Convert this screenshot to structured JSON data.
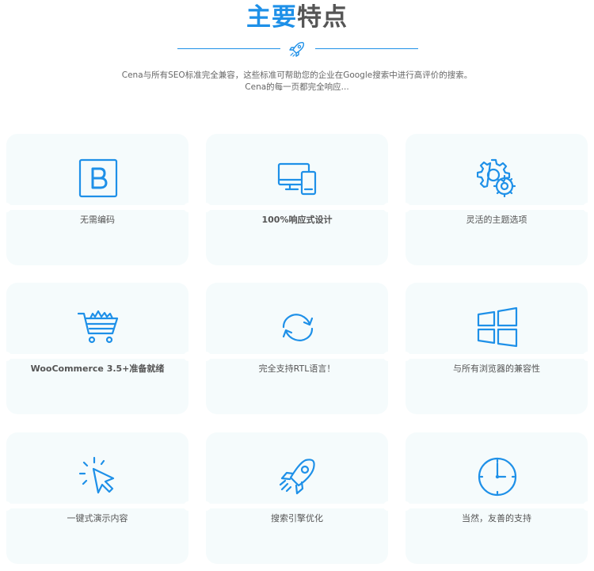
{
  "header": {
    "title_highlight": "主要",
    "title_rest": "特点",
    "intro_line1": "Cena与所有SEO标准完全兼容，这些标准可帮助您的企业在Google搜索中进行高评价的搜索。",
    "intro_line2": "Cena的每一页都完全响应..."
  },
  "colors": {
    "accent": "#1e90e8",
    "card_bg": "#f5fbfc",
    "text": "#555555"
  },
  "features": [
    {
      "label": "无需编码",
      "icon": "bootstrap-icon"
    },
    {
      "label": "100%响应式设计",
      "icon": "responsive-devices-icon"
    },
    {
      "label": "灵活的主题选项",
      "icon": "gears-icon"
    },
    {
      "label": "WooCommerce 3.5+准备就绪",
      "icon": "shopping-cart-icon"
    },
    {
      "label": "完全支持RTL语言！",
      "icon": "sync-arrows-icon"
    },
    {
      "label": "与所有浏览器的兼容性",
      "icon": "windows-icon"
    },
    {
      "label": "一键式演示内容",
      "icon": "cursor-click-icon"
    },
    {
      "label": "搜索引擎优化",
      "icon": "rocket-icon"
    },
    {
      "label": "当然，友善的支持",
      "icon": "clock-icon"
    }
  ]
}
